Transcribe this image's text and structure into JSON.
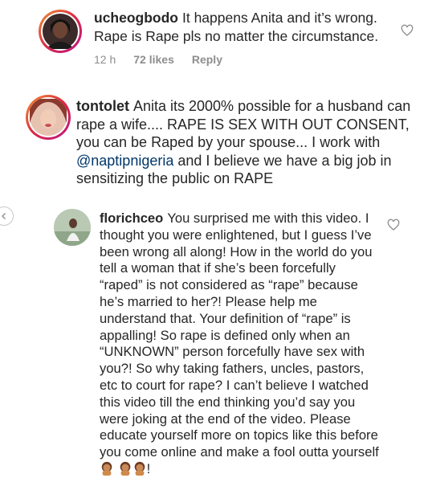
{
  "comments": [
    {
      "username": "ucheogbodo",
      "text": "It happens Anita and it’s wrong. Rape is Rape pls no matter the circumstance.",
      "time": "12 h",
      "likes": "72 likes",
      "reply": "Reply"
    },
    {
      "username": "tontolet",
      "text_before": "Anita its 2000% possible for a husband can rape a wife.... RAPE IS SEX WITH OUT CONSENT, you can be Raped by your spouse... I work with ",
      "mention": "@naptipnigeria",
      "text_after": " and I believe we have a big job in sensitizing the public on RAPE"
    },
    {
      "username": "florichceo",
      "text": "You surprised me with this video. I thought you were enlightened, but I guess I’ve been wrong all along! How in the world do you tell a woman that if she’s been forcefully “raped” is not considered as “rape” because he’s married to her?! Please help me understand that. Your definition of “rape” is appalling! So rape is defined only when an “UNKNOWN” person forcefully have sex with you?! So why taking fathers, uncles, pastors, etc to court for rape? I can’t believe I watched this video till the end thinking you’d say you were joking at the end of the video. Please educate yourself more on topics like this before you come online and make a fool outta yourself",
      "text_end": "!"
    }
  ],
  "icons": {
    "heart": "heart-outline-icon",
    "arrow": "chevron-left-icon",
    "emoji": "person-facepalming-emoji"
  },
  "colors": {
    "text": "#262626",
    "meta": "#8e8e8e",
    "mention": "#00376b",
    "story_ring": "#c13584"
  }
}
